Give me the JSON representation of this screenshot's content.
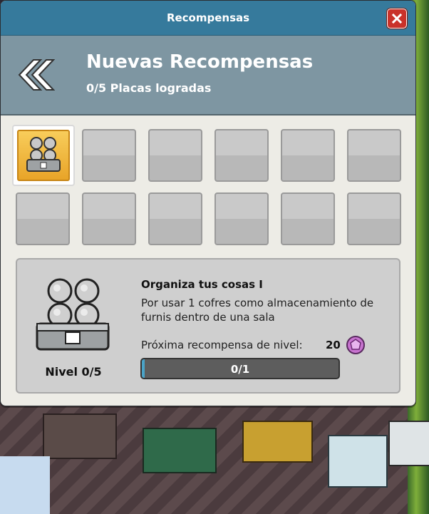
{
  "window": {
    "title": "Recompensas"
  },
  "header": {
    "title": "Nuevas Recompensas",
    "subtitle": "0/5 Placas logradas"
  },
  "grid": {
    "slots_total": 12,
    "selected_index": 0
  },
  "achievement": {
    "title": "Organiza tus cosas I",
    "description": "Por usar 1 cofres como almacenamiento de furnis dentro de una sala",
    "level_text": "Nivel 0/5",
    "next_reward_label": "Próxima recompensa de nivel:",
    "next_reward_value": "20",
    "reward_icon": "purple-gem-icon",
    "progress_text": "0/1",
    "progress_fraction": 0.0
  },
  "colors": {
    "titlebar": "#367a9c",
    "header": "#7e96a2",
    "close": "#c9322a",
    "selected_slot": "#f8cd5b",
    "progress_bg": "#5d5d5d"
  }
}
